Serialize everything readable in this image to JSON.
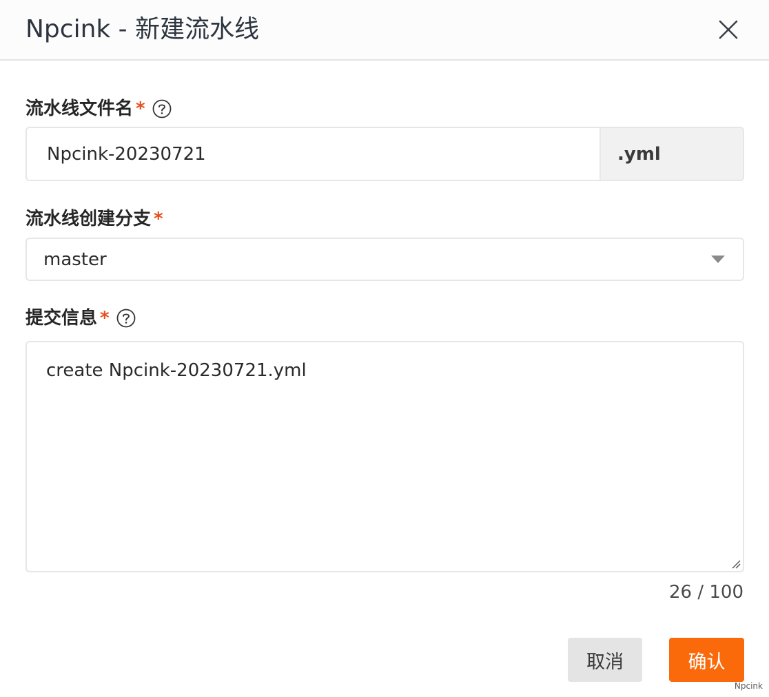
{
  "dialog": {
    "title": "Npcink - 新建流水线",
    "close_icon": "close-icon"
  },
  "fields": {
    "filename": {
      "label": "流水线文件名",
      "required_mark": "*",
      "help_icon": "question-circle-icon",
      "value": "Npcink-20230721",
      "suffix": ".yml"
    },
    "branch": {
      "label": "流水线创建分支",
      "required_mark": "*",
      "selected": "master",
      "caret_icon": "caret-down-icon"
    },
    "commit_message": {
      "label": "提交信息",
      "required_mark": "*",
      "help_icon": "question-circle-icon",
      "value": "create Npcink-20230721.yml",
      "counter": "26 / 100"
    }
  },
  "buttons": {
    "cancel_label": "取消",
    "confirm_label": "确认"
  },
  "colors": {
    "accent": "#fa6a0a",
    "required": "#e6501e"
  },
  "watermark": "Npcink"
}
